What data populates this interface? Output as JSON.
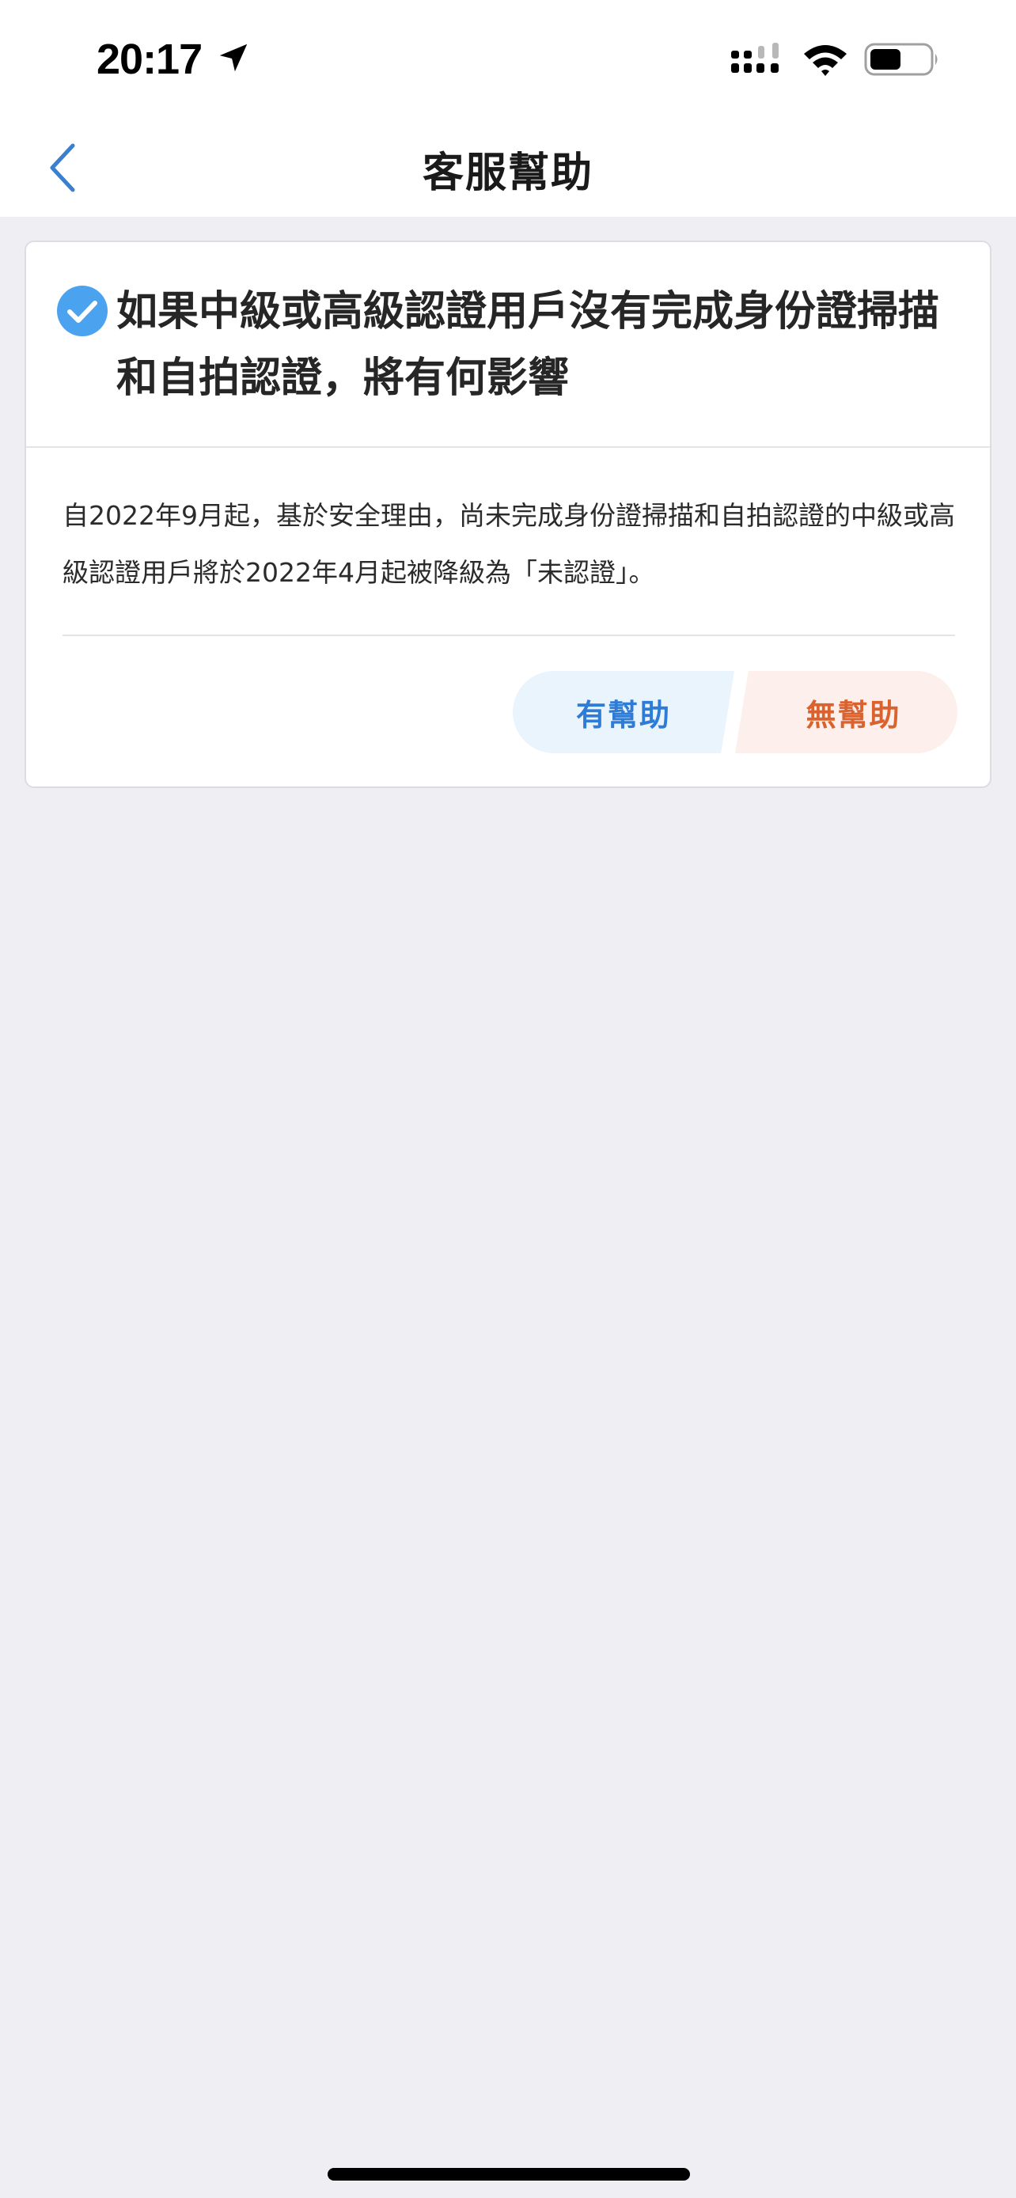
{
  "status_bar": {
    "time": "20:17",
    "icons": [
      "location-arrow-icon",
      "cellular-signal-icon",
      "wifi-icon",
      "battery-icon"
    ]
  },
  "nav": {
    "back_icon": "chevron-left-icon",
    "title": "客服幫助"
  },
  "card": {
    "check_icon": "check-circle-icon",
    "question": "如果中級或高級認證用戶沒有完成身份證掃描和自拍認證，將有何影響",
    "answer": "自2022年9月起，基於安全理由，尚未完成身份證掃描和自拍認證的中級或高級認證用戶將於2022年4月起被降級為「未認證」。",
    "helpful_label": "有幫助",
    "unhelpful_label": "無幫助"
  },
  "colors": {
    "accent_blue": "#2F7CD6",
    "check_blue": "#4BA3F0",
    "unhelpful_orange": "#D9622E",
    "background": "#EEEEF3"
  }
}
